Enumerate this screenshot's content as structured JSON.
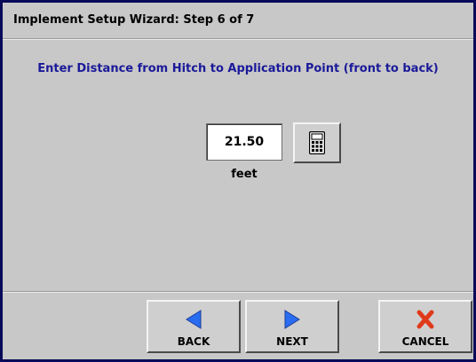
{
  "header": {
    "title": "Implement Setup Wizard:  Step 6 of 7"
  },
  "main": {
    "instruction": "Enter Distance from Hitch to Application Point (front to back)",
    "distance_value": "21.50",
    "unit": "feet",
    "calculator_icon": "calculator-icon"
  },
  "footer": {
    "back_label": "BACK",
    "back_icon": "left-arrow-icon",
    "next_label": "NEXT",
    "next_icon": "right-arrow-icon",
    "cancel_label": "CANCEL",
    "cancel_icon": "red-x-icon"
  },
  "colors": {
    "window_border": "#0a0a5a",
    "background": "#c8c8c8",
    "instruction_text": "#1a1a9a",
    "arrow_blue": "#2a6cf0",
    "cancel_red": "#e03a1a"
  }
}
